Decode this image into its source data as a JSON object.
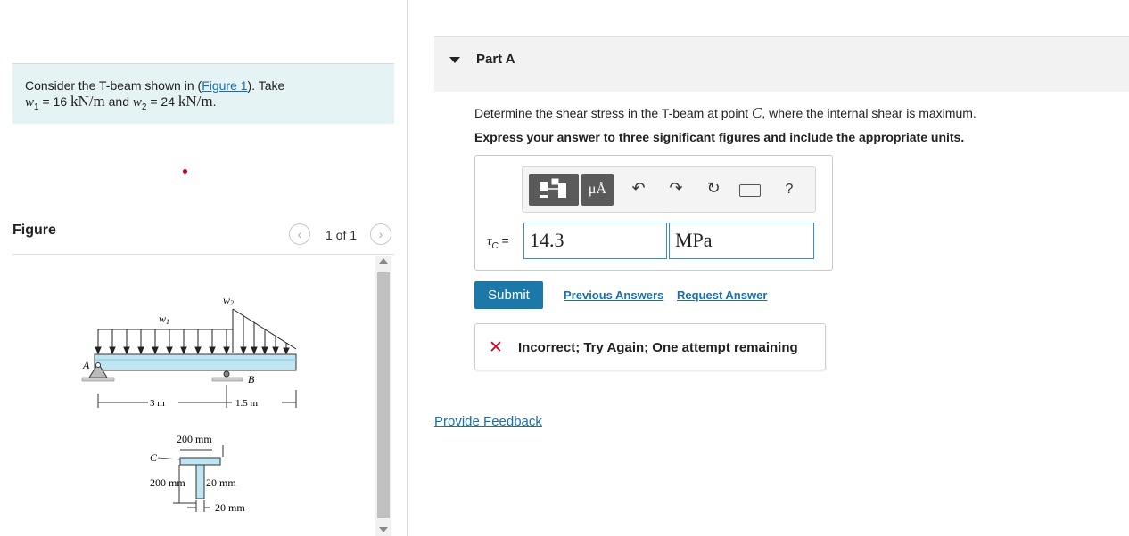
{
  "problem": {
    "text_pre": "Consider the T-beam shown in (",
    "figure_link": "Figure 1",
    "text_post": "). Take",
    "w1_sym": "w",
    "w1_sub": "1",
    "w1_eq": " = 16 ",
    "w1_unit": "kN/m",
    "and": " and ",
    "w2_sym": "w",
    "w2_sub": "2",
    "w2_eq": " = 24 ",
    "w2_unit": "kN/m",
    "period": "."
  },
  "figure": {
    "label": "Figure",
    "counter": "1 of 1",
    "prev_icon": "‹",
    "next_icon": "›",
    "labels": {
      "w1": "w",
      "w1_sub": "1",
      "w2": "w",
      "w2_sub": "2",
      "A": "A",
      "B": "B",
      "C": "C",
      "dim_3m": "3 m",
      "dim_15m": "1.5 m",
      "dim_200_top": "200 mm",
      "dim_200_side": "200 mm",
      "dim_20_web": "20 mm",
      "dim_20_bottom": "20 mm"
    }
  },
  "part_a": {
    "title": "Part A",
    "question_pre": "Determine the shear stress in the T-beam at point ",
    "question_point": "C",
    "question_post": ", where the internal shear is maximum.",
    "instruction": "Express your answer to three significant figures and include the appropriate units.",
    "toolbar": {
      "units_label": "μÅ",
      "undo": "↶",
      "redo": "↷",
      "reset": "↻",
      "help": "?"
    },
    "answer_label_sym": "τ",
    "answer_label_sub": "C",
    "answer_label_eq": " =",
    "value": "14.3",
    "unit": "MPa",
    "submit": "Submit",
    "previous_answers": "Previous Answers",
    "request_answer": "Request Answer",
    "feedback_icon": "✕",
    "feedback": "Incorrect; Try Again; One attempt remaining",
    "provide_feedback": "Provide Feedback"
  }
}
